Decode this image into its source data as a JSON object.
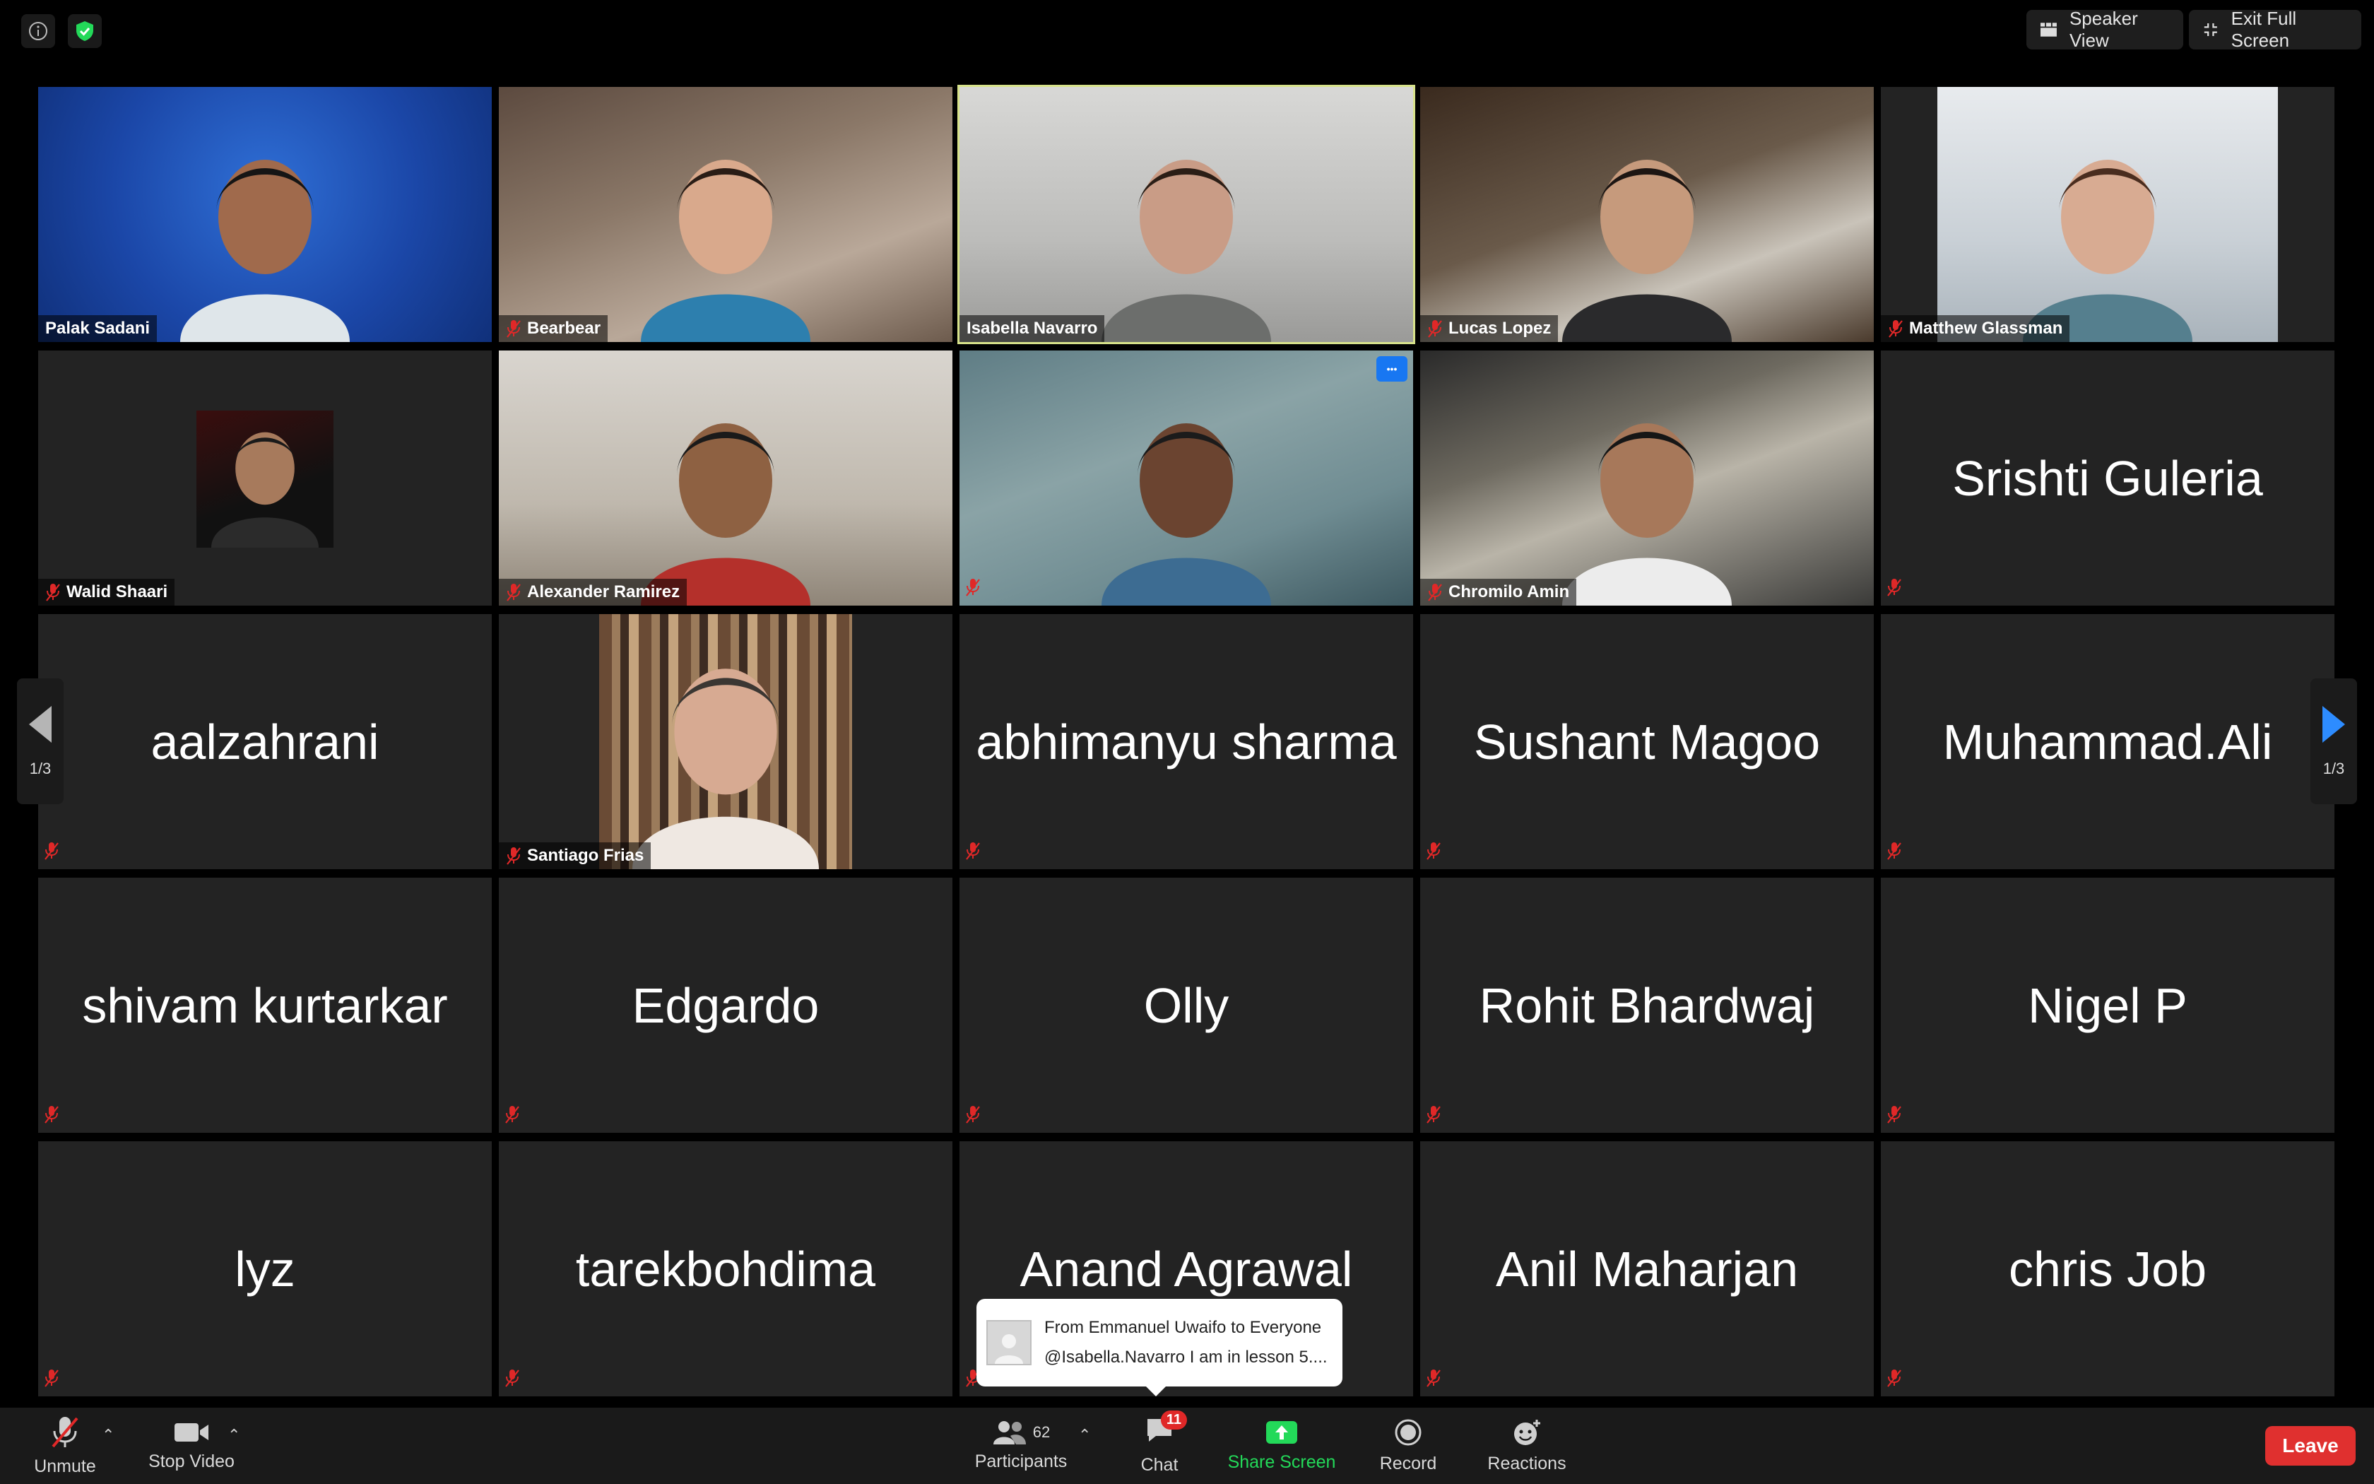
{
  "topbar": {
    "speaker_view_label": "Speaker View",
    "exit_fullscreen_label": "Exit Full Screen"
  },
  "pagination": {
    "left_label": "1/3",
    "right_label": "1/3"
  },
  "tiles": [
    {
      "name": "Palak Sadani",
      "video": "v-blue",
      "muted": false
    },
    {
      "name": "Bearbear",
      "video": "v-room1",
      "muted": true
    },
    {
      "name": "Isabella Navarro",
      "video": "v-grey",
      "muted": false,
      "speaking": true
    },
    {
      "name": "Lucas Lopez",
      "video": "v-dark",
      "muted": true
    },
    {
      "name": "Matthew Glassman",
      "video": "v-office",
      "muted": true
    },
    {
      "name": "Walid Shaari",
      "video": "avatar",
      "muted": true
    },
    {
      "name": "Alexander Ramirez",
      "video": "v-wall",
      "muted": true
    },
    {
      "name": "",
      "video": "v-teal",
      "muted": true,
      "more": true
    },
    {
      "name": "Chromilo Amin",
      "video": "v-dim",
      "muted": true
    },
    {
      "name": "Srishti Guleria",
      "video": "none",
      "muted": true
    },
    {
      "name": "aalzahrani",
      "video": "none",
      "muted": true
    },
    {
      "name": "Santiago Frias",
      "video": "books",
      "muted": true
    },
    {
      "name": "abhimanyu sharma",
      "video": "none",
      "muted": true
    },
    {
      "name": "Sushant Magoo",
      "video": "none",
      "muted": true
    },
    {
      "name": "Muhammad.Ali",
      "video": "none",
      "muted": true
    },
    {
      "name": "shivam kurtarkar",
      "video": "none",
      "muted": true
    },
    {
      "name": "Edgardo",
      "video": "none",
      "muted": true
    },
    {
      "name": "Olly",
      "video": "none",
      "muted": true
    },
    {
      "name": "Rohit Bhardwaj",
      "video": "none",
      "muted": true
    },
    {
      "name": "Nigel P",
      "video": "none",
      "muted": true
    },
    {
      "name": "lyz",
      "video": "none",
      "muted": true
    },
    {
      "name": "tarekbohdima",
      "video": "none",
      "muted": true
    },
    {
      "name": "Anand Agrawal",
      "video": "none",
      "muted": true
    },
    {
      "name": "Anil Maharjan",
      "video": "none",
      "muted": true
    },
    {
      "name": "chris Job",
      "video": "none",
      "muted": true
    }
  ],
  "chat_popup": {
    "header": "From Emmanuel Uwaifo to Everyone",
    "message": "@Isabella.Navarro I am in lesson 5...."
  },
  "toolbar": {
    "unmute_label": "Unmute",
    "stop_video_label": "Stop Video",
    "participants_label": "Participants",
    "participants_count": "62",
    "chat_label": "Chat",
    "chat_badge": "11",
    "share_screen_label": "Share Screen",
    "record_label": "Record",
    "reactions_label": "Reactions",
    "leave_label": "Leave"
  },
  "colors": {
    "speaking_outline": "#d7e28a",
    "share_green": "#23d959",
    "leave_red": "#e0302f",
    "mute_red": "#e02828",
    "accent_blue": "#1877f2"
  }
}
